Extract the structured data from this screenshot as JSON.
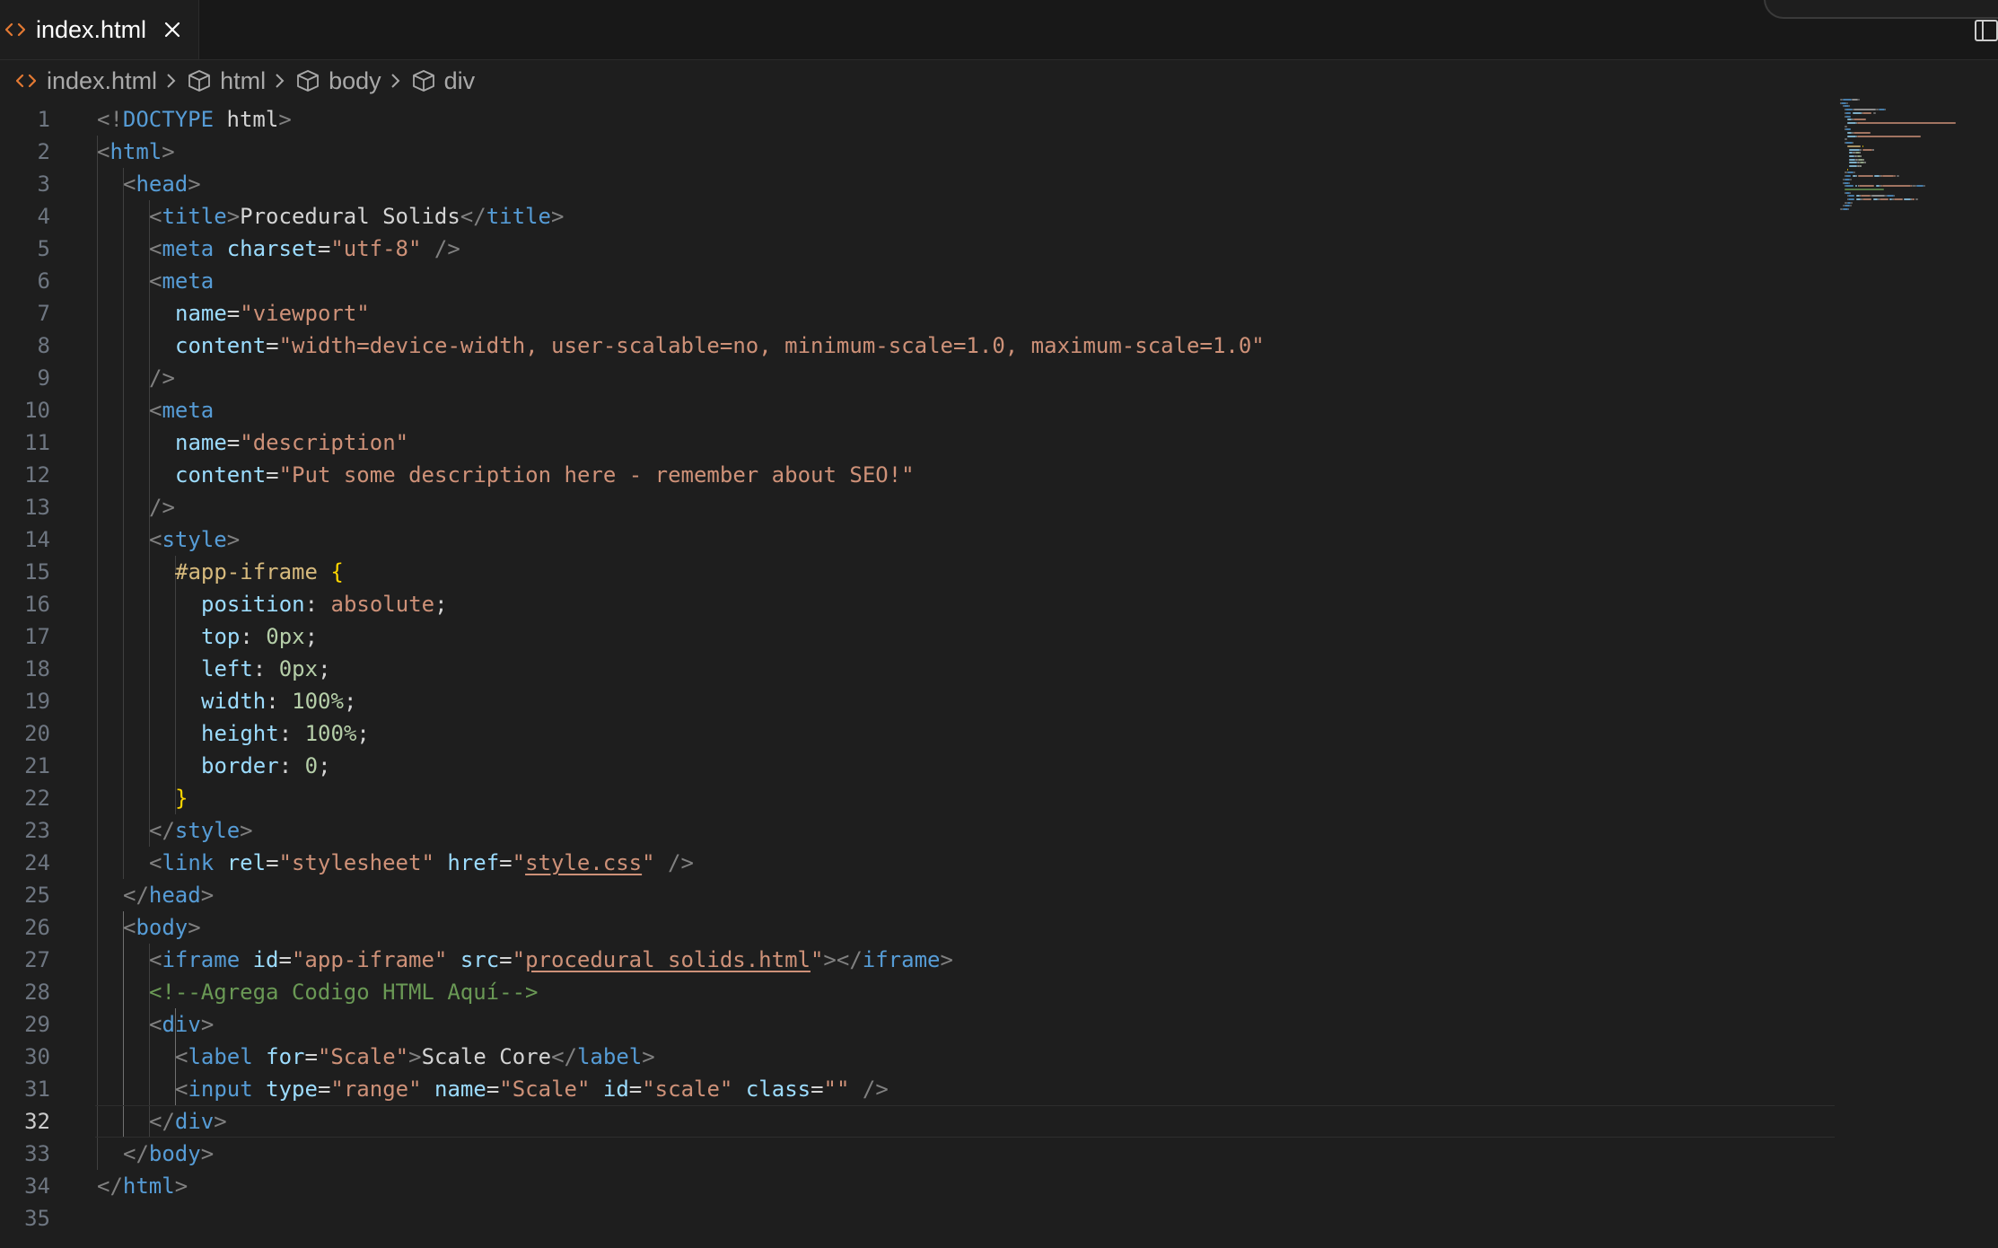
{
  "colors": {
    "editor_bg": "#1e1e1e",
    "tag": "#569cd6",
    "attribute": "#9cdcfe",
    "string": "#ce9178",
    "comment": "#6a9955",
    "selector": "#d7ba7d",
    "number": "#b5cea8",
    "brace": "#ffd700",
    "punctuation": "#808080",
    "html_file_icon": "#e37933"
  },
  "tab": {
    "label": "index.html",
    "icon": "html-file-icon",
    "close_icon": "close-icon"
  },
  "toolbar": {
    "split_icon": "split-editor-icon"
  },
  "breadcrumb": {
    "file": "index.html",
    "items": [
      "html",
      "body",
      "div"
    ],
    "item_icon": "cube-icon",
    "separator_icon": "chevron-right-icon"
  },
  "editor": {
    "active_line": 32,
    "lines": [
      [
        [
          "p",
          "<!"
        ],
        [
          "g",
          "DOCTYPE"
        ],
        [
          "x",
          " html"
        ],
        [
          "p",
          ">"
        ]
      ],
      [
        [
          "p",
          "<"
        ],
        [
          "g",
          "html"
        ],
        [
          "p",
          ">"
        ]
      ],
      [
        [
          "p",
          "<"
        ],
        [
          "g",
          "head"
        ],
        [
          "p",
          ">"
        ]
      ],
      [
        [
          "p",
          "<"
        ],
        [
          "g",
          "title"
        ],
        [
          "p",
          ">"
        ],
        [
          "x",
          "Procedural Solids"
        ],
        [
          "p",
          "</"
        ],
        [
          "g",
          "title"
        ],
        [
          "p",
          ">"
        ]
      ],
      [
        [
          "p",
          "<"
        ],
        [
          "g",
          "meta"
        ],
        [
          "x",
          " "
        ],
        [
          "a",
          "charset"
        ],
        [
          "x",
          "="
        ],
        [
          "s",
          "\"utf-8\""
        ],
        [
          "x",
          " "
        ],
        [
          "p",
          "/>"
        ]
      ],
      [
        [
          "p",
          "<"
        ],
        [
          "g",
          "meta"
        ]
      ],
      [
        [
          "a",
          "name"
        ],
        [
          "x",
          "="
        ],
        [
          "s",
          "\"viewport\""
        ]
      ],
      [
        [
          "a",
          "content"
        ],
        [
          "x",
          "="
        ],
        [
          "s",
          "\"width=device-width, user-scalable=no, minimum-scale=1.0, maximum-scale=1.0\""
        ]
      ],
      [
        [
          "p",
          "/>"
        ]
      ],
      [
        [
          "p",
          "<"
        ],
        [
          "g",
          "meta"
        ]
      ],
      [
        [
          "a",
          "name"
        ],
        [
          "x",
          "="
        ],
        [
          "s",
          "\"description\""
        ]
      ],
      [
        [
          "a",
          "content"
        ],
        [
          "x",
          "="
        ],
        [
          "s",
          "\"Put some description here - remember about SEO!\""
        ]
      ],
      [
        [
          "p",
          "/>"
        ]
      ],
      [
        [
          "p",
          "<"
        ],
        [
          "g",
          "style"
        ],
        [
          "p",
          ">"
        ]
      ],
      [
        [
          "e",
          "#app-iframe"
        ],
        [
          "x",
          " "
        ],
        [
          "b",
          "{"
        ]
      ],
      [
        [
          "r",
          "position"
        ],
        [
          "x",
          ": "
        ],
        [
          "v",
          "absolute"
        ],
        [
          "x",
          ";"
        ]
      ],
      [
        [
          "r",
          "top"
        ],
        [
          "x",
          ": "
        ],
        [
          "n",
          "0px"
        ],
        [
          "x",
          ";"
        ]
      ],
      [
        [
          "r",
          "left"
        ],
        [
          "x",
          ": "
        ],
        [
          "n",
          "0px"
        ],
        [
          "x",
          ";"
        ]
      ],
      [
        [
          "r",
          "width"
        ],
        [
          "x",
          ": "
        ],
        [
          "n",
          "100%"
        ],
        [
          "x",
          ";"
        ]
      ],
      [
        [
          "r",
          "height"
        ],
        [
          "x",
          ": "
        ],
        [
          "n",
          "100%"
        ],
        [
          "x",
          ";"
        ]
      ],
      [
        [
          "r",
          "border"
        ],
        [
          "x",
          ": "
        ],
        [
          "n",
          "0"
        ],
        [
          "x",
          ";"
        ]
      ],
      [
        [
          "b",
          "}"
        ]
      ],
      [
        [
          "p",
          "</"
        ],
        [
          "g",
          "style"
        ],
        [
          "p",
          ">"
        ]
      ],
      [
        [
          "p",
          "<"
        ],
        [
          "g",
          "link"
        ],
        [
          "x",
          " "
        ],
        [
          "a",
          "rel"
        ],
        [
          "x",
          "="
        ],
        [
          "s",
          "\"stylesheet\""
        ],
        [
          "x",
          " "
        ],
        [
          "a",
          "href"
        ],
        [
          "x",
          "="
        ],
        [
          "s",
          "\""
        ],
        [
          "u",
          "style.css"
        ],
        [
          "s",
          "\""
        ],
        [
          "x",
          " "
        ],
        [
          "p",
          "/>"
        ]
      ],
      [
        [
          "p",
          "</"
        ],
        [
          "g",
          "head"
        ],
        [
          "p",
          ">"
        ]
      ],
      [
        [
          "p",
          "<"
        ],
        [
          "g",
          "body"
        ],
        [
          "p",
          ">"
        ]
      ],
      [
        [
          "p",
          "<"
        ],
        [
          "g",
          "iframe"
        ],
        [
          "x",
          " "
        ],
        [
          "a",
          "id"
        ],
        [
          "x",
          "="
        ],
        [
          "s",
          "\"app-iframe\""
        ],
        [
          "x",
          " "
        ],
        [
          "a",
          "src"
        ],
        [
          "x",
          "="
        ],
        [
          "s",
          "\""
        ],
        [
          "u",
          "procedural_solids.html"
        ],
        [
          "s",
          "\""
        ],
        [
          "p",
          "></"
        ],
        [
          "g",
          "iframe"
        ],
        [
          "p",
          ">"
        ]
      ],
      [
        [
          "c",
          "<!--Agrega Codigo HTML Aquí-->"
        ]
      ],
      [
        [
          "p",
          "<"
        ],
        [
          "g",
          "div"
        ],
        [
          "p",
          ">"
        ]
      ],
      [
        [
          "p",
          "<"
        ],
        [
          "g",
          "label"
        ],
        [
          "x",
          " "
        ],
        [
          "a",
          "for"
        ],
        [
          "x",
          "="
        ],
        [
          "s",
          "\"Scale\""
        ],
        [
          "p",
          ">"
        ],
        [
          "x",
          "Scale Core"
        ],
        [
          "p",
          "</"
        ],
        [
          "g",
          "label"
        ],
        [
          "p",
          ">"
        ]
      ],
      [
        [
          "p",
          "<"
        ],
        [
          "g",
          "input"
        ],
        [
          "x",
          " "
        ],
        [
          "a",
          "type"
        ],
        [
          "x",
          "="
        ],
        [
          "s",
          "\"range\""
        ],
        [
          "x",
          " "
        ],
        [
          "a",
          "name"
        ],
        [
          "x",
          "="
        ],
        [
          "s",
          "\"Scale\""
        ],
        [
          "x",
          " "
        ],
        [
          "a",
          "id"
        ],
        [
          "x",
          "="
        ],
        [
          "s",
          "\"scale\""
        ],
        [
          "x",
          " "
        ],
        [
          "a",
          "class"
        ],
        [
          "x",
          "="
        ],
        [
          "s",
          "\"\""
        ],
        [
          "x",
          " "
        ],
        [
          "p",
          "/>"
        ]
      ],
      [
        [
          "p",
          "</"
        ],
        [
          "g",
          "div"
        ],
        [
          "p",
          ">"
        ]
      ],
      [
        [
          "p",
          "</"
        ],
        [
          "g",
          "body"
        ],
        [
          "p",
          ">"
        ]
      ],
      [
        [
          "p",
          "</"
        ],
        [
          "g",
          "html"
        ],
        [
          "p",
          ">"
        ]
      ],
      []
    ]
  }
}
